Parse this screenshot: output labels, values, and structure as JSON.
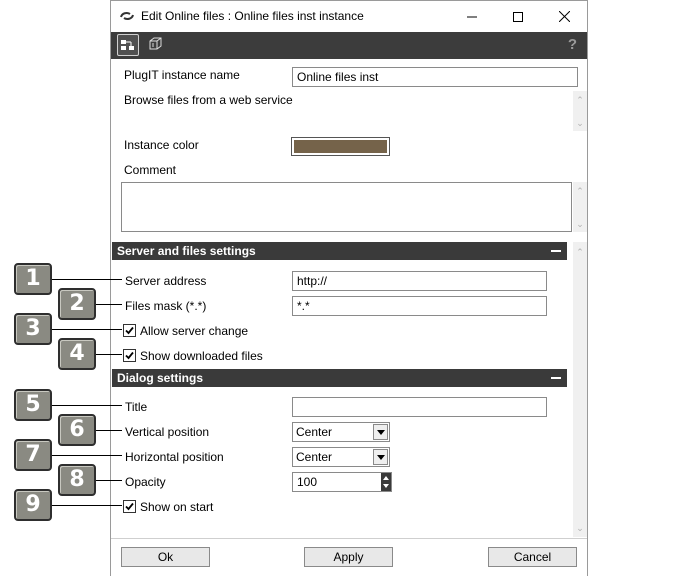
{
  "window": {
    "title": "Edit Online files : Online files inst instance"
  },
  "titlebar_buttons": {
    "minimize": "minimize-icon",
    "maximize": "maximize-icon",
    "close": "close-icon"
  },
  "toolbar": {
    "tools": [
      "tree-view-icon",
      "cube-icon"
    ],
    "help": "?"
  },
  "form": {
    "instance_name_label": "PlugIT instance name",
    "instance_name_value": "Online files inst",
    "description": "Browse files from a web service",
    "instance_color_label": "Instance color",
    "instance_color": "#75634a",
    "comment_label": "Comment",
    "comment_value": ""
  },
  "server_section": {
    "title": "Server and files settings",
    "server_address_label": "Server address",
    "server_address_value": "http://",
    "files_mask_label": "Files mask (*.*)",
    "files_mask_value": "*.*",
    "allow_server_change_label": "Allow server change",
    "allow_server_change": true,
    "show_downloaded_label": "Show downloaded files",
    "show_downloaded": true
  },
  "dialog_section": {
    "title": "Dialog settings",
    "title_label": "Title",
    "title_value": "",
    "vertical_label": "Vertical position",
    "vertical_value": "Center",
    "horizontal_label": "Horizontal position",
    "horizontal_value": "Center",
    "opacity_label": "Opacity",
    "opacity_value": "100",
    "show_on_start_label": "Show on start",
    "show_on_start": true
  },
  "buttons": {
    "ok": "Ok",
    "apply": "Apply",
    "cancel": "Cancel"
  },
  "callouts": [
    "1",
    "2",
    "3",
    "4",
    "5",
    "6",
    "7",
    "8",
    "9"
  ]
}
